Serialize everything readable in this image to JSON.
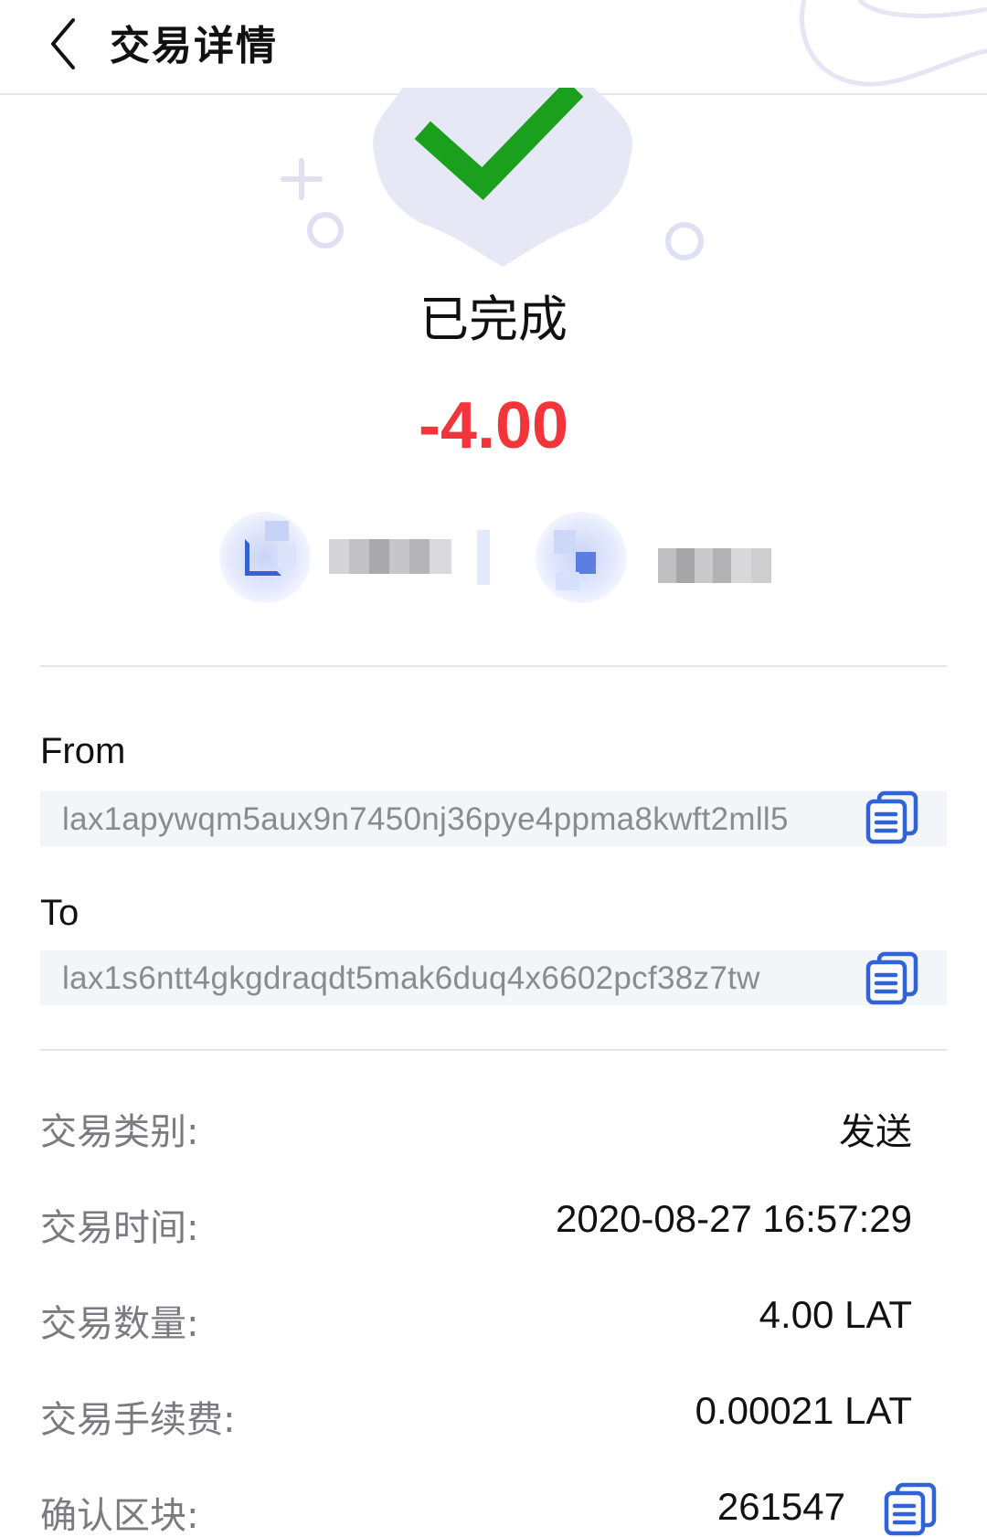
{
  "header": {
    "title": "交易详情",
    "icons": {
      "back": "chevron-left-icon"
    }
  },
  "status": {
    "text": "已完成",
    "amount": "-4.00",
    "colors": {
      "check": "#1aa01c",
      "badge": "#e6e8f5",
      "amount": "#f2353a"
    }
  },
  "transfer": {
    "from_label": "From",
    "from_address": "lax1apywqm5aux9n7450nj36pye4ppma8kwft2mll5",
    "to_label": "To",
    "to_address": "lax1s6ntt4gkgdraqdt5mak6duq4x6602pcf38z7tw",
    "icons": {
      "copy": "copy-icon"
    }
  },
  "details": [
    {
      "label": "交易类别:",
      "value": "发送"
    },
    {
      "label": "交易时间:",
      "value": "2020-08-27 16:57:29"
    },
    {
      "label": "交易数量:",
      "value": "4.00 LAT"
    },
    {
      "label": "交易手续费:",
      "value": "0.00021 LAT"
    },
    {
      "label": "确认区块:",
      "value": "261547"
    }
  ],
  "colors": {
    "accent": "#2f63d8",
    "muted_text": "#7a7a80",
    "divider": "#e3e5ec"
  }
}
